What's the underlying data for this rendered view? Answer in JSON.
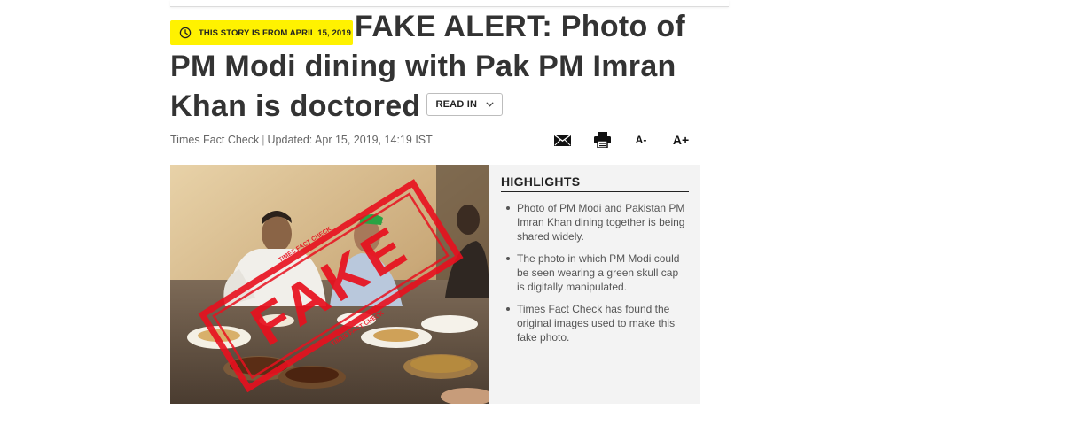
{
  "story_badge": {
    "icon": "clock-icon",
    "text": "THIS STORY IS FROM APRIL 15, 2019",
    "color": "#fff200"
  },
  "article": {
    "title": "FAKE ALERT: Photo of PM Modi dining with Pak PM Imran Khan is doctored",
    "read_in_label": "READ IN",
    "source": "Times Fact Check",
    "updated": "Updated: Apr 15, 2019, 14:19 IST"
  },
  "toolbar": {
    "mail_icon": "envelope-icon",
    "print_icon": "printer-icon",
    "decrease_font_label": "A-",
    "increase_font_label": "A+"
  },
  "image": {
    "stamp_text": "FAKE",
    "stamp_border_text": "TIMES FACT CHECK",
    "stamp_color": "#e8101e"
  },
  "highlights": {
    "title": "HIGHLIGHTS",
    "items": [
      "Photo of PM Modi and Pakistan PM Imran Khan dining together is being shared widely.",
      "The photo in which PM Modi could be seen wearing a green skull cap is digitally manipulated.",
      "Times Fact Check has found the original images used to make this fake photo."
    ]
  }
}
